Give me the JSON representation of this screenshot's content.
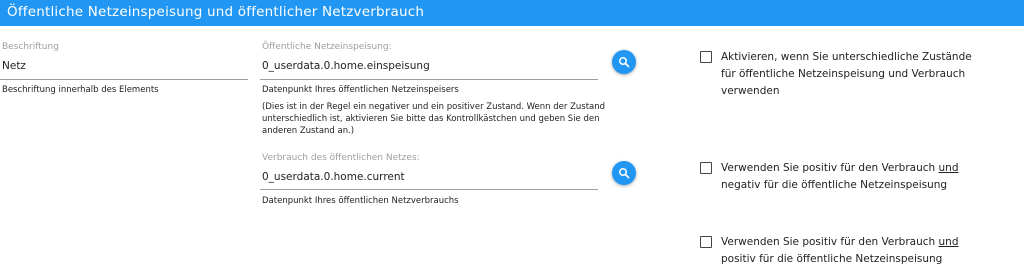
{
  "header": {
    "title": "Öffentliche Netzeinspeisung und öffentlicher Netzverbrauch"
  },
  "caption": {
    "label": "Beschriftung",
    "value": "Netz",
    "helper": "Beschriftung innerhalb des Elements"
  },
  "feed_in": {
    "label": "Öffentliche Netzeinspeisung:",
    "value": "0_userdata.0.home.einspeisung",
    "helper": "Datenpunkt Ihres öffentlichen Netzeinspeisers",
    "note": "(Dies ist in der Regel ein negativer und ein positiver Zustand. Wenn der Zustand unterschiedlich ist, aktivieren Sie bitte das Kontrollkästchen und geben Sie den anderen Zustand an.)",
    "button_icon": "search-icon"
  },
  "consumption": {
    "label": "Verbrauch des öffentlichen Netzes:",
    "value": "0_userdata.0.home.current",
    "helper": "Datenpunkt Ihres öffentlichen Netzverbrauchs",
    "button_icon": "search-icon"
  },
  "checkboxes": [
    {
      "line1": "Aktivieren, wenn Sie unterschiedliche Zustände",
      "line2": "für öffentliche Netzeinspeisung und Verbrauch",
      "line3": "verwenden",
      "checked": false
    },
    {
      "line1_pre": "Verwenden Sie positiv für den Verbrauch ",
      "line1_u": "und",
      "line2": "negativ für die öffentliche Netzeinspeisung",
      "checked": false
    },
    {
      "line1_pre": "Verwenden Sie positiv für den Verbrauch ",
      "line1_u": "und",
      "line2": "positiv für die öffentliche Netzeinspeisung",
      "checked": false
    }
  ],
  "colors": {
    "accent": "#2196f3",
    "label": "#9e9e9e",
    "text": "#222222"
  }
}
